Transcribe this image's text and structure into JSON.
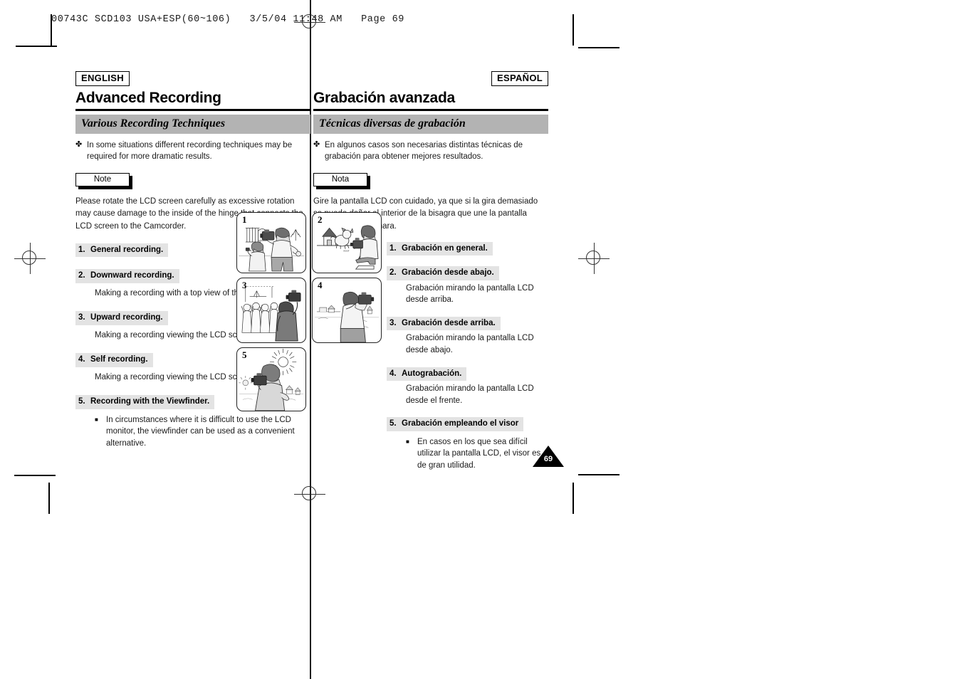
{
  "printer_slug": "00743C SCD103 USA+ESP(60~106)   3/5/04 11:48 AM   Page 69",
  "page_number": "69",
  "english": {
    "lang_tag": "ENGLISH",
    "chapter_title": "Advanced Recording",
    "section_title": "Various Recording Techniques",
    "intro_bullet_glyph": "✤",
    "intro_bullet": "In some situations different recording techniques may be required for more dramatic results.",
    "note_label": "Note",
    "note_body": "Please rotate the LCD screen carefully as excessive rotation may cause damage to the inside of the hinge that connects the LCD screen to the Camcorder.",
    "items": [
      {
        "index": "1.",
        "heading": "General recording.",
        "body": ""
      },
      {
        "index": "2.",
        "heading": "Downward recording.",
        "body": "Making a recording with a top view of the LCD screen."
      },
      {
        "index": "3.",
        "heading": "Upward recording.",
        "body": "Making a recording viewing the LCD screen from below."
      },
      {
        "index": "4.",
        "heading": "Self recording.",
        "body": "Making a recording viewing the LCD screen from the front."
      },
      {
        "index": "5.",
        "heading": "Recording with the Viewfinder.",
        "sub_bullet": "In circumstances where it is difficult to use the LCD monitor, the viewfinder can be used as a convenient alternative."
      }
    ]
  },
  "spanish": {
    "lang_tag": "ESPAÑOL",
    "chapter_title": "Grabación avanzada",
    "section_title": "Técnicas diversas de grabación",
    "intro_bullet_glyph": "✤",
    "intro_bullet": "En algunos casos son necesarias distintas técnicas de grabación para obtener mejores resultados.",
    "note_label": "Nota",
    "note_body": "Gire la pantalla LCD con cuidado, ya que si la gira demasiado se puede dañar el interior de la bisagra que une la pantalla LCD a la videocámara.",
    "items": [
      {
        "index": "1.",
        "heading": "Grabación en general.",
        "body": ""
      },
      {
        "index": "2.",
        "heading": "Grabación desde abajo.",
        "body": "Grabación mirando la pantalla LCD desde arriba."
      },
      {
        "index": "3.",
        "heading": "Grabación desde arriba.",
        "body": "Grabación mirando la pantalla LCD desde abajo."
      },
      {
        "index": "4.",
        "heading": "Autograbación.",
        "body": "Grabación mirando la pantalla LCD desde el frente."
      },
      {
        "index": "5.",
        "heading": "Grabación empleando el visor",
        "sub_bullet": "En casos en los que sea difícil utilizar la pantalla LCD, el visor es de gran utilidad."
      }
    ]
  },
  "figures": [
    {
      "number": "1",
      "caption": "general-recording-illustration"
    },
    {
      "number": "2",
      "caption": "downward-recording-illustration"
    },
    {
      "number": "3",
      "caption": "upward-recording-illustration"
    },
    {
      "number": "4",
      "caption": "self-recording-illustration"
    },
    {
      "number": "5",
      "caption": "viewfinder-recording-illustration"
    }
  ],
  "colors": {
    "banner_gray": "#b3b3b3",
    "heading_gray": "#e3e3e3",
    "rule_black": "#000000"
  }
}
